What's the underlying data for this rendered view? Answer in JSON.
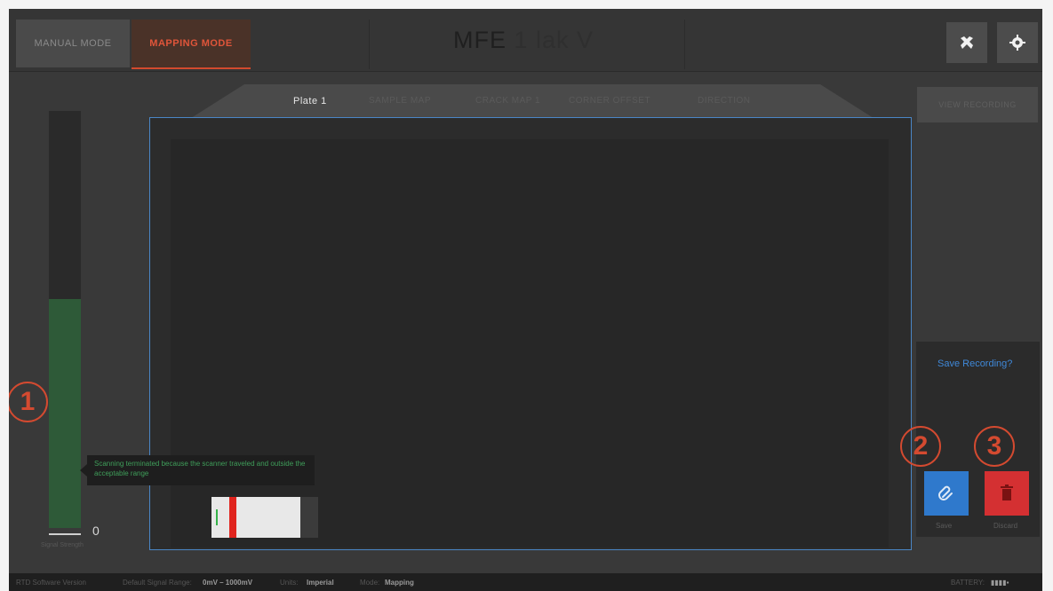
{
  "header": {
    "manual_mode": "MANUAL MODE",
    "mapping_mode": "MAPPING MODE",
    "title_main": "MFE",
    "title_rest": "1 lak V",
    "tools_icon": "tools-icon",
    "settings_icon": "gear-icon"
  },
  "tabs": [
    {
      "label": "Plate 1"
    },
    {
      "label": "SAMPLE MAP"
    },
    {
      "label": "CRACK MAP 1"
    },
    {
      "label": "CORNER OFFSET"
    },
    {
      "label": "DIRECTION"
    }
  ],
  "top_right_button": "VIEW RECORDING",
  "meter": {
    "zero_label": "0",
    "caption": "Signal Strength",
    "level": 0.55,
    "fill_color": "#2e5a38"
  },
  "tooltip": {
    "text": "Scanning terminated because the scanner traveled and outside the acceptable range"
  },
  "save_panel": {
    "title": "Save Recording?",
    "save_label": "Save",
    "discard_label": "Discard",
    "save_color": "#2f79cc",
    "discard_color": "#d43032"
  },
  "callouts": [
    "1",
    "2",
    "3"
  ],
  "status": {
    "version_label": "RTD Software Version",
    "range_label": "Default Signal Range:",
    "range_value": "0mV – 1000mV",
    "units_label": "Units:",
    "units_value": "Imperial",
    "mode_label": "Mode:",
    "mode_value": "Mapping",
    "battery_label": "BATTERY:",
    "battery_value": "▮▮▮▮▪"
  },
  "colors": {
    "accent_orange": "#d34a2e",
    "map_border": "#4a86c6"
  }
}
